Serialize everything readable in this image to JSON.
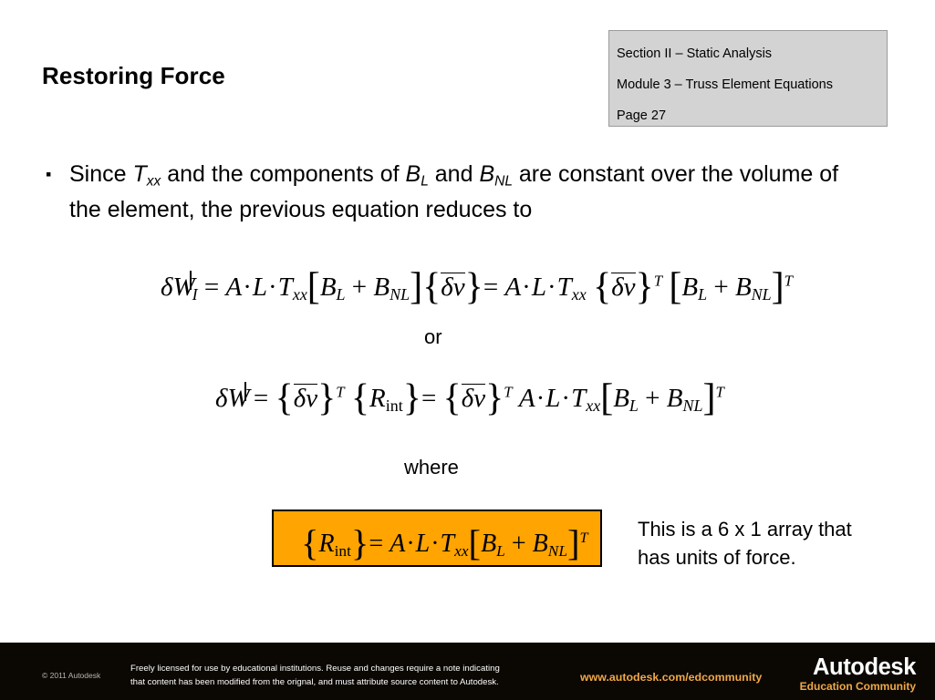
{
  "header": {
    "lines": [
      "Section II – Static Analysis",
      "Module 3 – Truss Element Equations",
      "Page 27"
    ],
    "background_color": "#d3d3d3",
    "border_color": "#9b9b9b"
  },
  "title": "Restoring Force",
  "bullet": {
    "marker": "▪",
    "text_part1": "Since ",
    "var_T": "T",
    "var_T_sub": "xx",
    "text_part2": " and the components of ",
    "var_B1": "B",
    "var_B1_sub": "L",
    "text_part3": " and ",
    "var_B2": "B",
    "var_B2_sub": "NL",
    "text_part4": " are constant over the volume of the element, the previous equation reduces to"
  },
  "equations": {
    "eq1_latex": "δW_I = A·L·T_xx [B_L + B_NL]{δv̅} = A·L·T_xx {δv̅}^T [B_L + B_NL]^T",
    "eq2_latex": "δW = {δv̅}^T {R_int} = {δv̅}^T A·L·T_xx [B_L + B_NL]^T",
    "eq3_latex": "{R_int} = A·L·T_xx [B_L + B_NL]^T",
    "symbols": {
      "delta": "δ",
      "W": "W",
      "v": "v",
      "A": "A",
      "L": "L",
      "T": "T",
      "R": "R",
      "B": "B",
      "dot": "·",
      "plus": "+",
      "equals": "=",
      "sub_I": "I",
      "sub_xx": "xx",
      "sub_int": "int",
      "sub_L": "L",
      "sub_NL": "NL",
      "sup_T": "T",
      "lbracket": "[",
      "rbracket": "]",
      "lbrace": "{",
      "rbrace": "}"
    }
  },
  "connectors": {
    "or": "or",
    "where": "where"
  },
  "highlight_box": {
    "fill_color": "#ffa400",
    "border_color": "#000000"
  },
  "note": "This is a 6 x 1 array that has units of force.",
  "footer": {
    "copyright": "© 2011 Autodesk",
    "license_line1": "Freely licensed for use by educational institutions. Reuse and changes require a note indicating",
    "license_line2": "that content has been modified from the orignal, and must attribute source content to Autodesk.",
    "url": "www.autodesk.com/edcommunity",
    "logo_name": "Autodesk",
    "logo_tagline": "Education Community",
    "background_color": "#0b0804",
    "accent_color": "#f0a847"
  }
}
